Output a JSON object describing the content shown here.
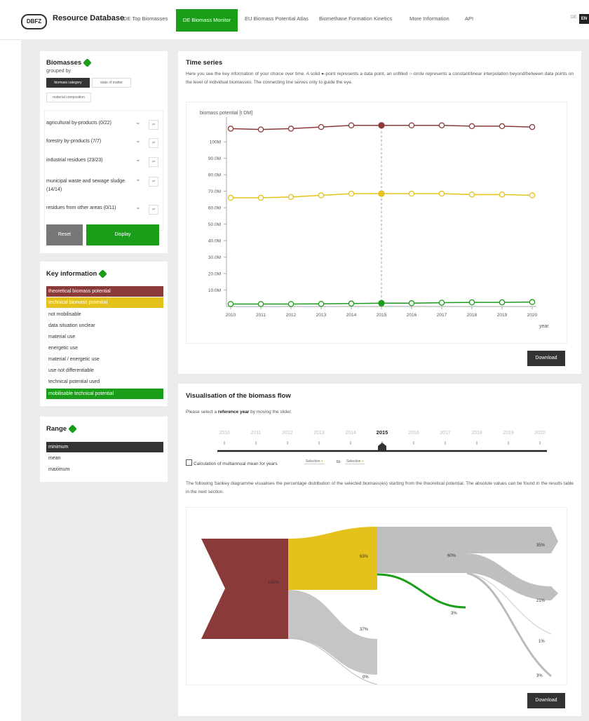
{
  "header": {
    "logo_text": "DBFZ",
    "brand": "Resource Database",
    "tabs": [
      {
        "label": "DE Top Biomasses"
      },
      {
        "label": "DE Biomass Monitor"
      },
      {
        "label": "EU Biomass Potential Atlas"
      },
      {
        "label": "Biomethane Formation Kinetics"
      },
      {
        "label": "More Information"
      },
      {
        "label": "API"
      }
    ],
    "active_tab": "DE Biomass Monitor",
    "lang_inactive": "DE",
    "lang_active": "EN"
  },
  "biomasses": {
    "title": "Biomasses",
    "grouped_by": "grouped by",
    "group_options": [
      "biomass category",
      "state of matter",
      "material composition"
    ],
    "selected_group": "biomass category",
    "categories": [
      {
        "label": "agricultural by-products  (0/22)"
      },
      {
        "label": "forestry by-products  (7/7)"
      },
      {
        "label": "industrial residues  (23/23)"
      },
      {
        "label": "municipal waste and sewage sludge  (14/14)"
      },
      {
        "label": "residues from other areas  (0/11)"
      }
    ],
    "reset_label": "Reset",
    "display_label": "Display"
  },
  "key_information": {
    "title": "Key information",
    "items": [
      {
        "label": "theoretical biomass potential",
        "color": "#8b3a3a"
      },
      {
        "label": "technical biomass potential",
        "color": "#e5c21b"
      },
      {
        "label": "not mobilisable",
        "color": ""
      },
      {
        "label": "data situation unclear",
        "color": ""
      },
      {
        "label": "material use",
        "color": ""
      },
      {
        "label": "energetic use",
        "color": ""
      },
      {
        "label": "material / energetic use",
        "color": ""
      },
      {
        "label": "use not differentiable",
        "color": ""
      },
      {
        "label": "technical potential used",
        "color": ""
      },
      {
        "label": "mobilisable technical potential",
        "color": "#1a9e1a"
      }
    ]
  },
  "range": {
    "title": "Range",
    "items": [
      "minimum",
      "mean",
      "maximum"
    ],
    "selected": "minimum"
  },
  "time_series": {
    "title": "Time series",
    "description": "Here you see the key information of your choice over time. A solid ●-point represents a data point, an unfilled ○-circle represents a constant/linear interpolation beyond/between data points on the level of individual biomasses. The connecting line serves only to guide the eye.",
    "download_label": "Download"
  },
  "chart_data": {
    "type": "line",
    "ylabel": "biomass potential [t DM]",
    "xlabel": "year",
    "x": [
      2010,
      2011,
      2012,
      2013,
      2014,
      2015,
      2016,
      2017,
      2018,
      2019,
      2020
    ],
    "ylim": [
      0,
      115000000
    ],
    "y_ticks": [
      "10.0M",
      "20.0M",
      "30.0M",
      "40.0M",
      "50.0M",
      "60.0M",
      "70.0M",
      "80.0M",
      "90.0M",
      "100M"
    ],
    "y_tick_values": [
      10000000,
      20000000,
      30000000,
      40000000,
      50000000,
      60000000,
      70000000,
      80000000,
      90000000,
      100000000
    ],
    "highlight_x": 2015,
    "series": [
      {
        "color": "#8b3a3a",
        "values": [
          108000000,
          107500000,
          108000000,
          109000000,
          110000000,
          110000000,
          110000000,
          110000000,
          109500000,
          109500000,
          109000000
        ]
      },
      {
        "color": "#e5c21b",
        "values": [
          66000000,
          66000000,
          66500000,
          67500000,
          68500000,
          68500000,
          68500000,
          68500000,
          68000000,
          68000000,
          67500000
        ]
      },
      {
        "color": "#1a9e1a",
        "values": [
          1500000,
          1500000,
          1500000,
          1600000,
          1800000,
          2000000,
          2000000,
          2300000,
          2500000,
          2500000,
          2700000
        ]
      }
    ]
  },
  "flow": {
    "title": "Visualisation of the biomass flow",
    "instruction_prefix": "Please select a ",
    "instruction_bold": "reference year",
    "instruction_suffix": " by moving the slider.",
    "years": [
      "2010",
      "2011",
      "2012",
      "2013",
      "2014",
      "2015",
      "2016",
      "2017",
      "2018",
      "2019",
      "2020"
    ],
    "selected_year": "2015",
    "multiannual_label": "Calculation of multiannual mean for years",
    "selection_from": "Selection",
    "to_label": "to",
    "selection_to": "Selection",
    "sankey_description": "The following Sankey diagramme visualises the percentage distribution of the selected biomass(es) starting from the theoretical potential. The absolute values can be found in the results table in the next section.",
    "sankey_labels": [
      "100%",
      "63%",
      "37%",
      "0%",
      "60%",
      "3%",
      "35%",
      "21%",
      "1%",
      "3%"
    ],
    "download_label": "Download"
  }
}
